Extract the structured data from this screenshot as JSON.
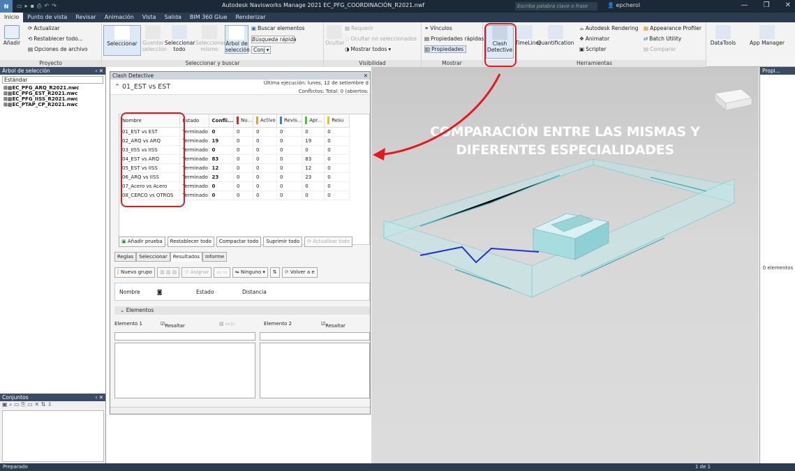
{
  "window": {
    "title": "Autodesk Navisworks Manage 2021   EC_PFG_COORDINACIÓN_R2021.nwf",
    "search_placeholder": "Escriba palabra clave o frase",
    "user": "epcherol",
    "logo": "N"
  },
  "tabs": [
    "Inicio",
    "Punto de vista",
    "Revisar",
    "Animación",
    "Vista",
    "Salida",
    "BIM 360 Glue",
    "Renderizar"
  ],
  "ribbon": {
    "proyecto": {
      "add": "Añadir",
      "update": "Actualizar",
      "reset": "Restablecer todo...",
      "options": "Opciones de archivo",
      "label": "Proyecto"
    },
    "select": {
      "select": "Seleccionar",
      "save_sel": "Guardar selección",
      "select_all": "Seleccionar todo",
      "select_same": "Seleccionar mismo",
      "tree": "Árbol de selección",
      "find": "Buscar elementos",
      "quick_search": "Búsqueda rápida",
      "sets": "Conj",
      "label": "Seleccionar y buscar"
    },
    "visibility": {
      "hide": "Ocultar",
      "require": "Requerir",
      "hide_unselected": "Ocultar no seleccionados",
      "show_all": "Mostrar todos",
      "label": "Visibilidad"
    },
    "display": {
      "links": "Vínculos",
      "quick_props": "Propiedades rápidas",
      "props": "Propiedades",
      "label": "Mostrar"
    },
    "tools": {
      "clash": "Clash Detective",
      "timeliner": "TimeLiner",
      "quantification": "Quantification",
      "rendering": "Autodesk Rendering",
      "animator": "Animator",
      "scripter": "Scripter",
      "appearance": "Appearance Profiler",
      "batch": "Batch Utility",
      "compare": "Comparar",
      "datatools": "DataTools",
      "appmanager": "App Manager",
      "label": "Herramientas"
    }
  },
  "left_panel": {
    "title": "Árbol de selección",
    "mode": "Estándar",
    "files": [
      "EC_PFG_ARQ_R2021.nwc",
      "EC_PFG_EST_R2021.nwc",
      "EC_PFG_IISS_R2021.nwc",
      "EC_PTAP_CP_R2021.nwc"
    ]
  },
  "sets_panel": {
    "title": "Conjuntos"
  },
  "clash": {
    "title": "Clash Detective",
    "test_name": "01_EST vs EST",
    "last_run": "Última ejecución:  lunes, 12 de setiembre d",
    "conflicts": "Conflictos:  Total:  0  (abiertos:",
    "columns": [
      "Nombre",
      "Estado",
      "Confli...",
      "Nu...",
      "Activo",
      "Revis...",
      "Apr...",
      "Resu"
    ],
    "column_colors": [
      "",
      "",
      "",
      "#d9262e",
      "#f0a01e",
      "#3e7fd6",
      "#54c23a",
      "#e8c51c"
    ],
    "rows": [
      {
        "name": "01_EST vs EST",
        "status": "Terminado",
        "conf": "0",
        "nu": "0",
        "act": "0",
        "rev": "0",
        "apr": "0",
        "res": "0"
      },
      {
        "name": "02_ARQ vs ARQ",
        "status": "Terminado",
        "conf": "19",
        "nu": "0",
        "act": "0",
        "rev": "0",
        "apr": "19",
        "res": "0"
      },
      {
        "name": "03_IISS vs IISS",
        "status": "Terminado",
        "conf": "0",
        "nu": "0",
        "act": "0",
        "rev": "0",
        "apr": "0",
        "res": "0"
      },
      {
        "name": "04_EST vs ARQ",
        "status": "Terminado",
        "conf": "83",
        "nu": "0",
        "act": "0",
        "rev": "0",
        "apr": "83",
        "res": "0"
      },
      {
        "name": "05_EST vs IISS",
        "status": "Terminado",
        "conf": "12",
        "nu": "0",
        "act": "0",
        "rev": "0",
        "apr": "12",
        "res": "0"
      },
      {
        "name": "06_ARQ vs IISS",
        "status": "Terminado",
        "conf": "23",
        "nu": "0",
        "act": "0",
        "rev": "0",
        "apr": "23",
        "res": "0"
      },
      {
        "name": "07_Acero vs Acero",
        "status": "Terminado",
        "conf": "0",
        "nu": "0",
        "act": "0",
        "rev": "0",
        "apr": "0",
        "res": "0"
      },
      {
        "name": "08_CERCO vs OTROS",
        "status": "Terminado",
        "conf": "0",
        "nu": "0",
        "act": "0",
        "rev": "0",
        "apr": "0",
        "res": "0"
      }
    ],
    "buttons": {
      "add_test": "Añadir prueba",
      "reset_all": "Restablecer todo",
      "compact_all": "Compactar todo",
      "delete_all": "Suprimir todo",
      "update_all": "Actualizar todo"
    },
    "subtabs": [
      "Reglas",
      "Seleccionar",
      "Resultados",
      "Informe"
    ],
    "results_bar": {
      "new_group": "Nuevo grupo",
      "assign": "Asignar",
      "none": "Ninguno",
      "rerun": "Volver a e"
    },
    "results_cols": {
      "name": "Nombre",
      "status": "Estado",
      "distance": "Distancia"
    },
    "elements": {
      "title": "Elementos",
      "el1": "Elemento 1",
      "el2": "Elemento 2",
      "highlight": "Resaltar"
    }
  },
  "viewport": {
    "headline_1": "COMPARACIÓN ENTRE LAS MISMAS Y",
    "headline_2": "DIFERENTES ESPECIALIDADES"
  },
  "props_panel": {
    "title": "Propi...",
    "count": "0 elementos"
  },
  "status": {
    "text": "Preparado",
    "page": "1 de 1"
  },
  "colors": {
    "highlight": "#e3191f",
    "titlebar": "#1b2838",
    "tabs": "#2b3c50"
  }
}
